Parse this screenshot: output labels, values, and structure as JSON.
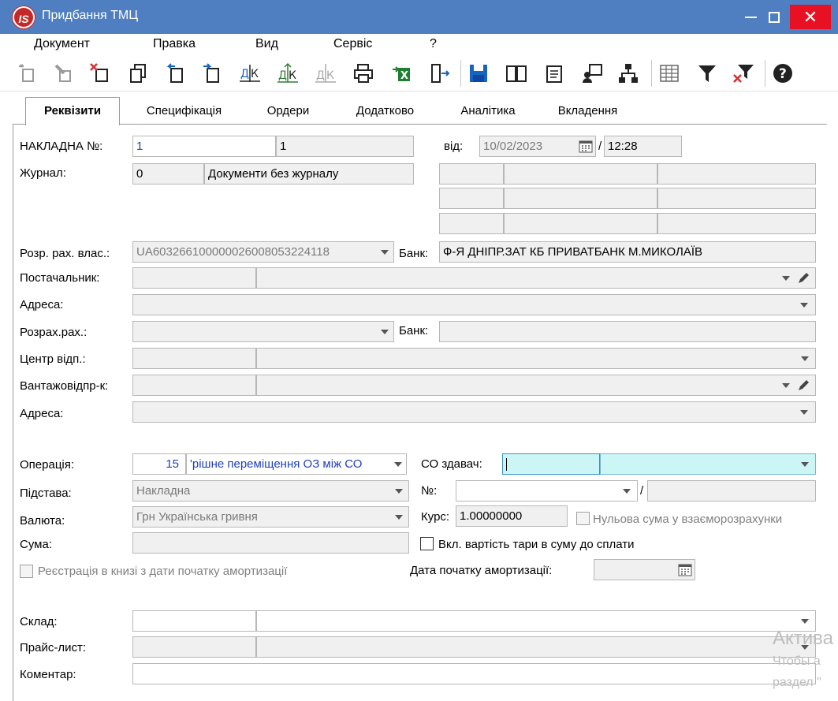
{
  "window": {
    "title": "Придбання ТМЦ",
    "logo": "IS"
  },
  "menu": [
    "Документ",
    "Правка",
    "Вид",
    "Сервіс",
    "?"
  ],
  "toolbar_icons": [
    "create-icon",
    "edit-icon",
    "delete-icon",
    "copy-icon",
    "import-icon",
    "export-icon",
    "dk-icon",
    "dk-up-icon",
    "dk-disabled-icon",
    "print-icon",
    "excel-icon",
    "exit-icon",
    "save-icon",
    "book-icon",
    "list-icon",
    "user-card-icon",
    "tree-icon",
    "grid-icon",
    "filter-icon",
    "filter-clear-icon",
    "help-icon"
  ],
  "tabs": [
    "Реквізити",
    "Специфікація",
    "Ордери",
    "Додатково",
    "Аналітика",
    "Вкладення"
  ],
  "form": {
    "invoice_label": "НАКЛАДНА №:",
    "invoice_no": "1",
    "invoice_no2": "1",
    "date_label": "від:",
    "date": "10/02/2023",
    "time_sep": "/",
    "time": "12:28",
    "journal_label": "Журнал:",
    "journal_code": "0",
    "journal_name": "Документи без журналу",
    "own_account_label": "Розр. рах. влас.:",
    "own_account": "UA603266100000026008053224118",
    "bank_label": "Банк:",
    "own_bank": "Ф-Я ДНІПР.ЗАТ КБ ПРИВАТБАНК М.МИКОЛАЇВ",
    "supplier_label": "Постачальник:",
    "address_label": "Адреса:",
    "account_label": "Розрах.рах.:",
    "bank2_label": "Банк:",
    "center_label": "Центр відп.:",
    "shipper_label": "Вантажовідпр-к:",
    "address2_label": "Адреса:",
    "operation_label": "Операція:",
    "operation_code": "15",
    "operation_name": "'рішне переміщення ОЗ між СО",
    "co_label": "СО здавач:",
    "basis_label": "Підстава:",
    "basis": "Накладна",
    "no_label": "№:",
    "no_sep": "/",
    "currency_label": "Валюта:",
    "currency": "Грн Українська гривня",
    "rate_label": "Курс:",
    "rate": "1.00000000",
    "zero_sum_label": "Нульова сума у взаєморозрахунки",
    "sum_label": "Сума:",
    "tare_label": "Вкл. вартість тари в суму до сплати",
    "register_label": "Реєстрація в книзі з дати початку амортизації",
    "amort_date_label": "Дата початку амортизації:",
    "warehouse_label": "Склад:",
    "pricelist_label": "Прайс-лист:",
    "comment_label": "Коментар:"
  },
  "watermark": [
    "Актива",
    "Чтобы а",
    "раздел \""
  ]
}
